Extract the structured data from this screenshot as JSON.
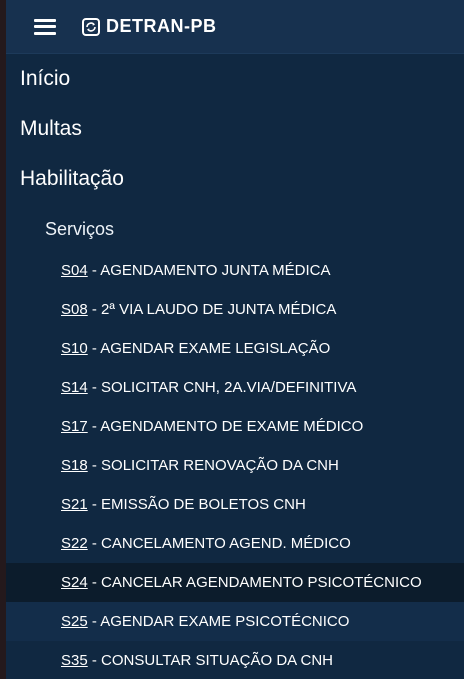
{
  "header": {
    "brand": "DETRAN-PB"
  },
  "menu": {
    "inicio": "Início",
    "multas": "Multas",
    "habilitacao": "Habilitação",
    "servicos": "Serviços",
    "items": [
      {
        "code": "S04",
        "label": " - AGENDAMENTO JUNTA MÉDICA"
      },
      {
        "code": "S08",
        "label": " - 2ª VIA LAUDO DE JUNTA MÉDICA"
      },
      {
        "code": "S10",
        "label": " - AGENDAR EXAME LEGISLAÇÃO"
      },
      {
        "code": "S14",
        "label": " - SOLICITAR CNH, 2A.VIA/DEFINITIVA"
      },
      {
        "code": "S17",
        "label": " - AGENDAMENTO DE EXAME MÉDICO"
      },
      {
        "code": "S18",
        "label": " - SOLICITAR RENOVAÇÃO DA CNH"
      },
      {
        "code": "S21",
        "label": " - EMISSÃO DE BOLETOS CNH"
      },
      {
        "code": "S22",
        "label": " - CANCELAMENTO AGEND. MÉDICO"
      },
      {
        "code": "S24",
        "label": " - CANCELAR AGENDAMENTO PSICOTÉCNICO"
      },
      {
        "code": "S25",
        "label": " - AGENDAR EXAME PSICOTÉCNICO"
      },
      {
        "code": "S35",
        "label": " - CONSULTAR SITUAÇÃO DA CNH"
      }
    ]
  },
  "colors": {
    "panel": "#102841",
    "header": "#17314f",
    "hover": "#0c1c2c"
  }
}
